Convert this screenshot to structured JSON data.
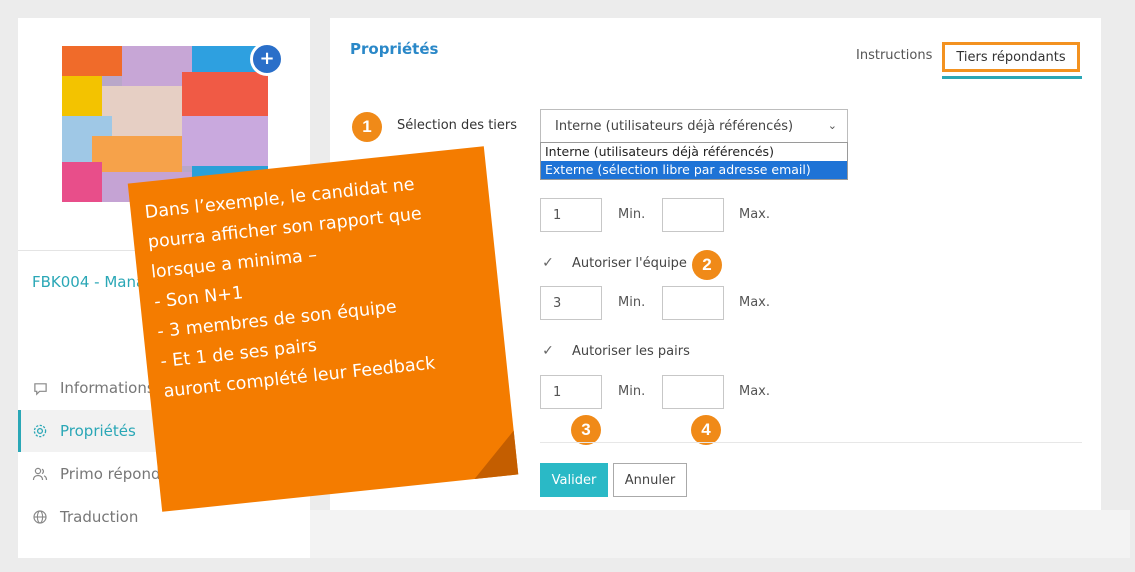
{
  "sidebar": {
    "project_title": "FBK004 - Mana",
    "items": [
      {
        "label": "Informations g",
        "icon": "chat-bubble-icon"
      },
      {
        "label": "Propriétés",
        "icon": "gear-icon",
        "active": true
      },
      {
        "label": "Primo répondar",
        "icon": "users-icon"
      },
      {
        "label": "Traduction",
        "icon": "globe-icon"
      }
    ],
    "badge_symbol": "+"
  },
  "main": {
    "title": "Propriétés",
    "tabs": [
      {
        "label": "Instructions",
        "active": false
      },
      {
        "label": "Tiers répondants",
        "active": true
      }
    ],
    "selection": {
      "label": "Sélection des tiers",
      "value": "Interne (utilisateurs déjà référencés)",
      "options": [
        "Interne (utilisateurs déjà référencés)",
        "Externe (sélection libre par adresse email)"
      ],
      "highlighted_index": 1
    },
    "rows": [
      {
        "min": "1",
        "min_label": "Min.",
        "max": "",
        "max_label": "Max."
      },
      {
        "checkbox_label": "Autoriser l'équipe",
        "checked": true,
        "min": "3",
        "min_label": "Min.",
        "max": "",
        "max_label": "Max."
      },
      {
        "checkbox_label": "Autoriser les pairs",
        "checked": true,
        "min": "1",
        "min_label": "Min.",
        "max": "",
        "max_label": "Max."
      }
    ],
    "buttons": {
      "validate": "Valider",
      "cancel": "Annuler"
    }
  },
  "annotations": {
    "steps": [
      "1",
      "2",
      "3",
      "4"
    ],
    "note_lines": [
      "Dans l’exemple, le candidat ne",
      "pourra afficher son rapport que",
      "lorsque a minima –",
      "-   Son N+1",
      "-   3 membres de son équipe",
      "-   Et 1 de ses pairs",
      "auront complété leur Feedback"
    ]
  },
  "colors": {
    "accent_teal": "#2aa7b6",
    "title_blue": "#2a88c8",
    "callout_orange": "#f47c00",
    "step_orange": "#f08a18",
    "dropdown_highlight": "#1e73d6"
  }
}
